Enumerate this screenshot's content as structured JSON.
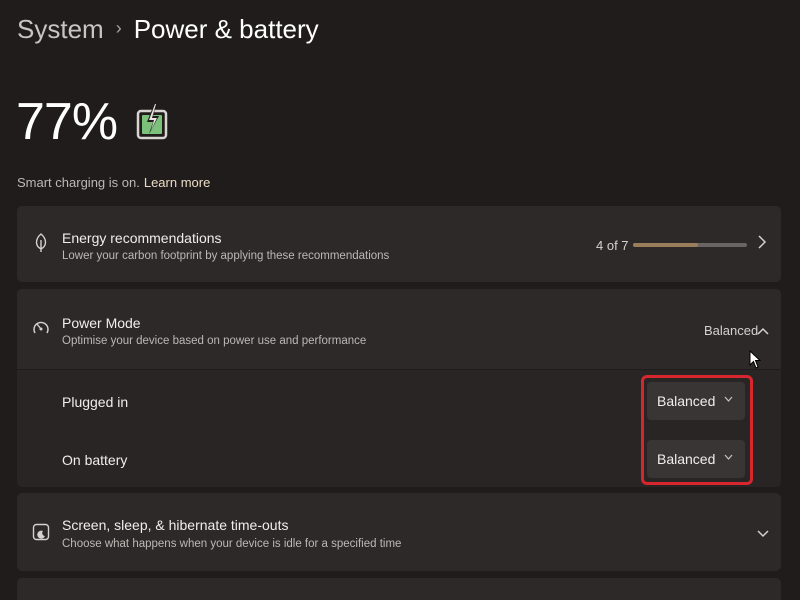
{
  "breadcrumb": {
    "parent": "System",
    "separator": "›",
    "current": "Power & battery"
  },
  "battery": {
    "percent": "77%",
    "icon": "battery-charging-icon",
    "level": 0.77
  },
  "smart_charging": {
    "text": "Smart charging is on.",
    "link": "Learn more"
  },
  "energy": {
    "title": "Energy recommendations",
    "subtitle": "Lower your carbon footprint by applying these recommendations",
    "progress_label": "4 of 7",
    "progress_fraction": 0.5714,
    "icon": "leaf-icon"
  },
  "power_mode": {
    "title": "Power Mode",
    "subtitle": "Optimise your device based on power use and performance",
    "value": "Balanced",
    "icon": "power-mode-icon",
    "plugged_in": {
      "label": "Plugged in",
      "value": "Balanced"
    },
    "on_battery": {
      "label": "On battery",
      "value": "Balanced"
    }
  },
  "screen_sleep": {
    "title": "Screen, sleep, & hibernate time-outs",
    "subtitle": "Choose what happens when your device is idle for a specified time",
    "icon": "screen-sleep-icon"
  },
  "colors": {
    "accent": "#9a7d5a",
    "highlight": "#d7262e",
    "background": "#1f1c1b",
    "card": "#2c2928"
  }
}
